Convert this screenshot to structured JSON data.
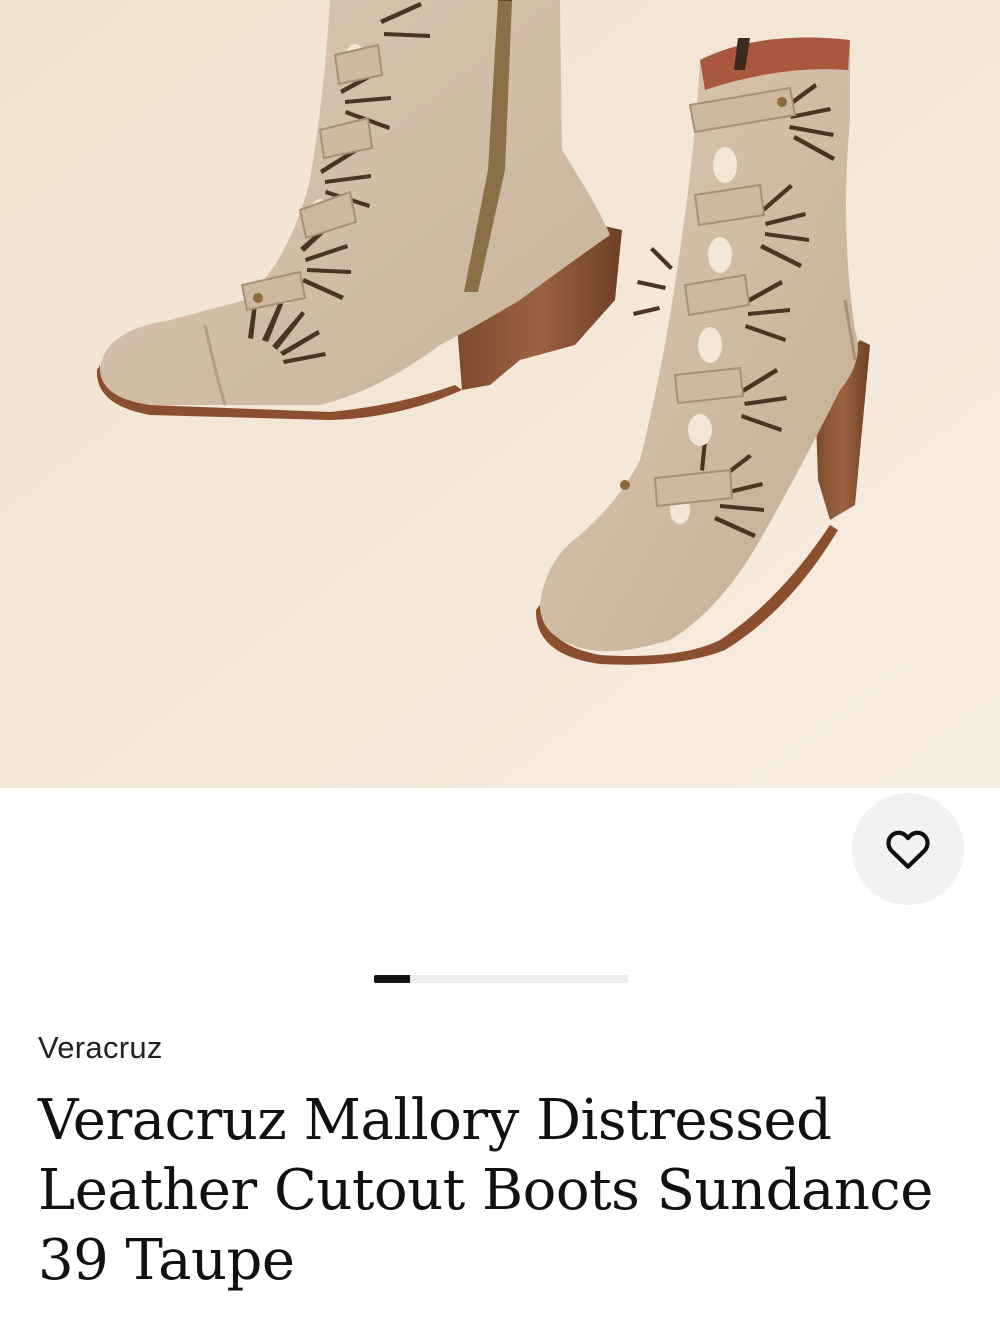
{
  "product": {
    "brand": "Veracruz",
    "title": "Veracruz Mallory Distressed Leather Cutout Boots Sundance 39 Taupe"
  },
  "gallery": {
    "current_progress": 0.14
  },
  "icons": {
    "favorite": "heart-outline-icon"
  },
  "colors": {
    "photo_background": "#f3e6d6",
    "leather": "#d6c3ad",
    "heel_wood": "#8f5636",
    "text": "#111111"
  }
}
